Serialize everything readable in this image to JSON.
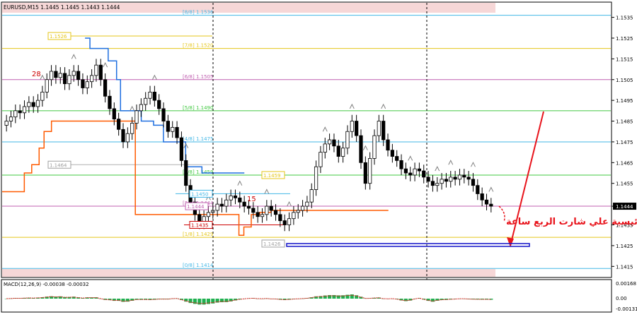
{
  "chart_data": {
    "type": "candlestick",
    "symbol": "EURUSD",
    "timeframe": "M15",
    "ohlc_header": "EURUSD,M15  1.1445 1.1445 1.1443 1.1444",
    "current_price": "1.1444",
    "ylim": [
      1.141,
      1.1542
    ],
    "y_ticks": [
      "1.1535",
      "1.1525",
      "1.1515",
      "1.1505",
      "1.1495",
      "1.1485",
      "1.1475",
      "1.1465",
      "1.1455",
      "1.1444",
      "1.1435",
      "1.1425",
      "1.1415"
    ],
    "murrey_levels": [
      {
        "label": "[8/8]",
        "price": 1.1536,
        "color": "#43b7e6"
      },
      {
        "label": "[7/8]",
        "price": 1.152,
        "color": "#e5c61a"
      },
      {
        "label": "[6/8]",
        "price": 1.1505,
        "color": "#c060b0"
      },
      {
        "label": "[5/8]",
        "price": 1.149,
        "color": "#40c840"
      },
      {
        "label": "[4/8]",
        "price": 1.1475,
        "color": "#43b7e6"
      },
      {
        "label": "[3/8]",
        "price": 1.1459,
        "color": "#40c840"
      },
      {
        "label": "[2/8]",
        "price": 1.1444,
        "color": "#c060b0"
      },
      {
        "label": "[1/8]",
        "price": 1.1429,
        "color": "#e5c61a"
      },
      {
        "label": "[0/8]",
        "price": 1.1414,
        "color": "#43b7e6"
      }
    ],
    "price_boxes": [
      {
        "text": "1.1526",
        "price": 1.1526,
        "color": "#e5c61a"
      },
      {
        "text": "1.1464",
        "price": 1.1464,
        "color": "#a0a0a0"
      },
      {
        "text": "1.1459",
        "price": 1.1459,
        "color": "#e5c61a"
      },
      {
        "text": "1.1450",
        "price": 1.145,
        "color": "#43b7e6"
      },
      {
        "text": "1.1444",
        "price": 1.1444,
        "color": "#c060b0"
      },
      {
        "text": "1.1435",
        "price": 1.1435,
        "color": "#cc0000"
      },
      {
        "text": "1.1426",
        "price": 1.1426,
        "color": "#a0a0a0"
      }
    ],
    "markers": [
      "28",
      "15"
    ],
    "annotation": "منطقة رئيسية علي شارت الربع ساعة",
    "macd": {
      "label": "MACD(12,26,9) -0.00038 -0.00032",
      "y_ticks": [
        "0.00168",
        "0.00",
        "-0.00131"
      ]
    },
    "series": [
      {
        "type": "candles",
        "open": [
          1.1483,
          1.1485,
          1.1487,
          1.149,
          1.1489,
          1.1492,
          1.1494,
          1.1492,
          1.1495,
          1.1499,
          1.1505,
          1.1509,
          1.1506,
          1.1508,
          1.1503,
          1.1507,
          1.1509,
          1.1505,
          1.1501,
          1.1504,
          1.1507,
          1.1512,
          1.1505,
          1.1497,
          1.1491,
          1.1486,
          1.1481,
          1.1475,
          1.1479,
          1.1484,
          1.149,
          1.1493,
          1.1496,
          1.1499,
          1.1495,
          1.1491,
          1.1485,
          1.148,
          1.1482,
          1.1477,
          1.1466,
          1.1454,
          1.1446,
          1.144,
          1.1436,
          1.1439,
          1.1441,
          1.1442,
          1.1445,
          1.1444,
          1.1447,
          1.1449,
          1.1448,
          1.1446,
          1.1444,
          1.1443,
          1.1441,
          1.1439,
          1.144,
          1.1444,
          1.1442,
          1.144,
          1.1437,
          1.1435,
          1.1438,
          1.1441,
          1.1442,
          1.1444,
          1.1446,
          1.1452,
          1.1463,
          1.147,
          1.1474,
          1.1476,
          1.1473,
          1.1468,
          1.1472,
          1.148,
          1.1485,
          1.1478,
          1.1465,
          1.1455,
          1.1467,
          1.1478,
          1.1485,
          1.1476,
          1.1471,
          1.1468,
          1.1466,
          1.1462,
          1.146,
          1.1459,
          1.1462,
          1.1461,
          1.1458,
          1.1456,
          1.1454,
          1.1455,
          1.1457,
          1.1456,
          1.1458,
          1.1457,
          1.1459,
          1.1458,
          1.1457,
          1.1454,
          1.145,
          1.1447,
          1.1445
        ],
        "close": [
          1.1485,
          1.1487,
          1.149,
          1.1489,
          1.1492,
          1.1494,
          1.1492,
          1.1495,
          1.1499,
          1.1505,
          1.1509,
          1.1506,
          1.1508,
          1.1503,
          1.1507,
          1.1509,
          1.1505,
          1.1501,
          1.1504,
          1.1507,
          1.1512,
          1.1505,
          1.1497,
          1.1491,
          1.1486,
          1.1481,
          1.1475,
          1.1479,
          1.1484,
          1.149,
          1.1493,
          1.1496,
          1.1499,
          1.1495,
          1.1491,
          1.1485,
          1.148,
          1.1482,
          1.1477,
          1.1466,
          1.1454,
          1.1446,
          1.144,
          1.1436,
          1.1439,
          1.1441,
          1.1442,
          1.1445,
          1.1444,
          1.1447,
          1.1449,
          1.1448,
          1.1446,
          1.1444,
          1.1443,
          1.1441,
          1.1439,
          1.144,
          1.1444,
          1.1442,
          1.144,
          1.1437,
          1.1435,
          1.1438,
          1.1441,
          1.1442,
          1.1444,
          1.1446,
          1.1452,
          1.1463,
          1.147,
          1.1474,
          1.1476,
          1.1473,
          1.1468,
          1.1472,
          1.148,
          1.1485,
          1.1478,
          1.1465,
          1.1455,
          1.1467,
          1.1478,
          1.1485,
          1.1476,
          1.1471,
          1.1468,
          1.1466,
          1.1462,
          1.146,
          1.1459,
          1.1462,
          1.1461,
          1.1458,
          1.1456,
          1.1454,
          1.1455,
          1.1457,
          1.1456,
          1.1458,
          1.1457,
          1.1459,
          1.1458,
          1.1457,
          1.1454,
          1.145,
          1.1447,
          1.1445,
          1.1444
        ]
      },
      {
        "type": "line",
        "name": "",
        "color": "#1f6fe0",
        "x": [
          0.168,
          0.178,
          0.205,
          0.215,
          0.232,
          0.24,
          0.265,
          0.282,
          0.307,
          0.327,
          0.372,
          0.405,
          0.438,
          0.491
        ],
        "y": [
          1.1525,
          1.152,
          1.152,
          1.1514,
          1.1505,
          1.149,
          1.149,
          1.1485,
          1.1483,
          1.1475,
          1.1463,
          1.146,
          1.146,
          1.146
        ]
      },
      {
        "type": "line",
        "name": "",
        "color": "#ff5a00",
        "x": [
          0.0,
          0.03,
          0.045,
          0.06,
          0.075,
          0.085,
          0.1,
          0.15,
          0.27,
          0.35,
          0.48,
          0.49,
          0.505,
          0.522,
          0.545,
          0.6,
          0.7,
          0.783
        ],
        "y": [
          1.1451,
          1.1451,
          1.146,
          1.1464,
          1.1472,
          1.148,
          1.1485,
          1.1485,
          1.144,
          1.144,
          1.143,
          1.1434,
          1.144,
          1.1441,
          1.1442,
          1.1442,
          1.1442,
          1.1442
        ]
      }
    ]
  }
}
